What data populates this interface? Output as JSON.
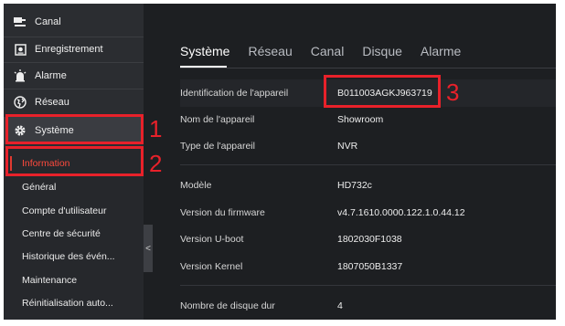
{
  "sidebar": {
    "items": [
      {
        "label": "Canal",
        "icon": "camera-icon"
      },
      {
        "label": "Enregistrement",
        "icon": "record-icon"
      },
      {
        "label": "Alarme",
        "icon": "alarm-icon"
      },
      {
        "label": "Réseau",
        "icon": "globe-icon"
      },
      {
        "label": "Système",
        "icon": "gear-icon"
      }
    ],
    "submenu": [
      {
        "label": "Information"
      },
      {
        "label": "Général"
      },
      {
        "label": "Compte d'utilisateur"
      },
      {
        "label": "Centre de sécurité"
      },
      {
        "label": "Historique des évén..."
      },
      {
        "label": "Maintenance"
      },
      {
        "label": "Réinitialisation auto..."
      }
    ],
    "collapse_label": "<"
  },
  "tabs": [
    "Système",
    "Réseau",
    "Canal",
    "Disque",
    "Alarme"
  ],
  "info": {
    "device_id": {
      "label": "Identification de l'appareil",
      "value": "B011003AGKJ963719"
    },
    "device_name": {
      "label": "Nom de l'appareil",
      "value": "Showroom"
    },
    "device_type": {
      "label": "Type de l'appareil",
      "value": "NVR"
    },
    "model": {
      "label": "Modèle",
      "value": "HD732c"
    },
    "firmware": {
      "label": "Version du firmware",
      "value": "v4.7.1610.0000.122.1.0.44.12"
    },
    "uboot": {
      "label": "Version U-boot",
      "value": "1802030F1038"
    },
    "kernel": {
      "label": "Version Kernel",
      "value": "1807050B1337"
    },
    "disks": {
      "label": "Nombre de disque dur",
      "value": "4"
    }
  },
  "annotations": [
    "1",
    "2",
    "3"
  ],
  "colors": {
    "accent": "#e8212a",
    "active_text": "#ff4a3d",
    "background": "#1d1f22",
    "sidebar": "#2b2d31"
  }
}
